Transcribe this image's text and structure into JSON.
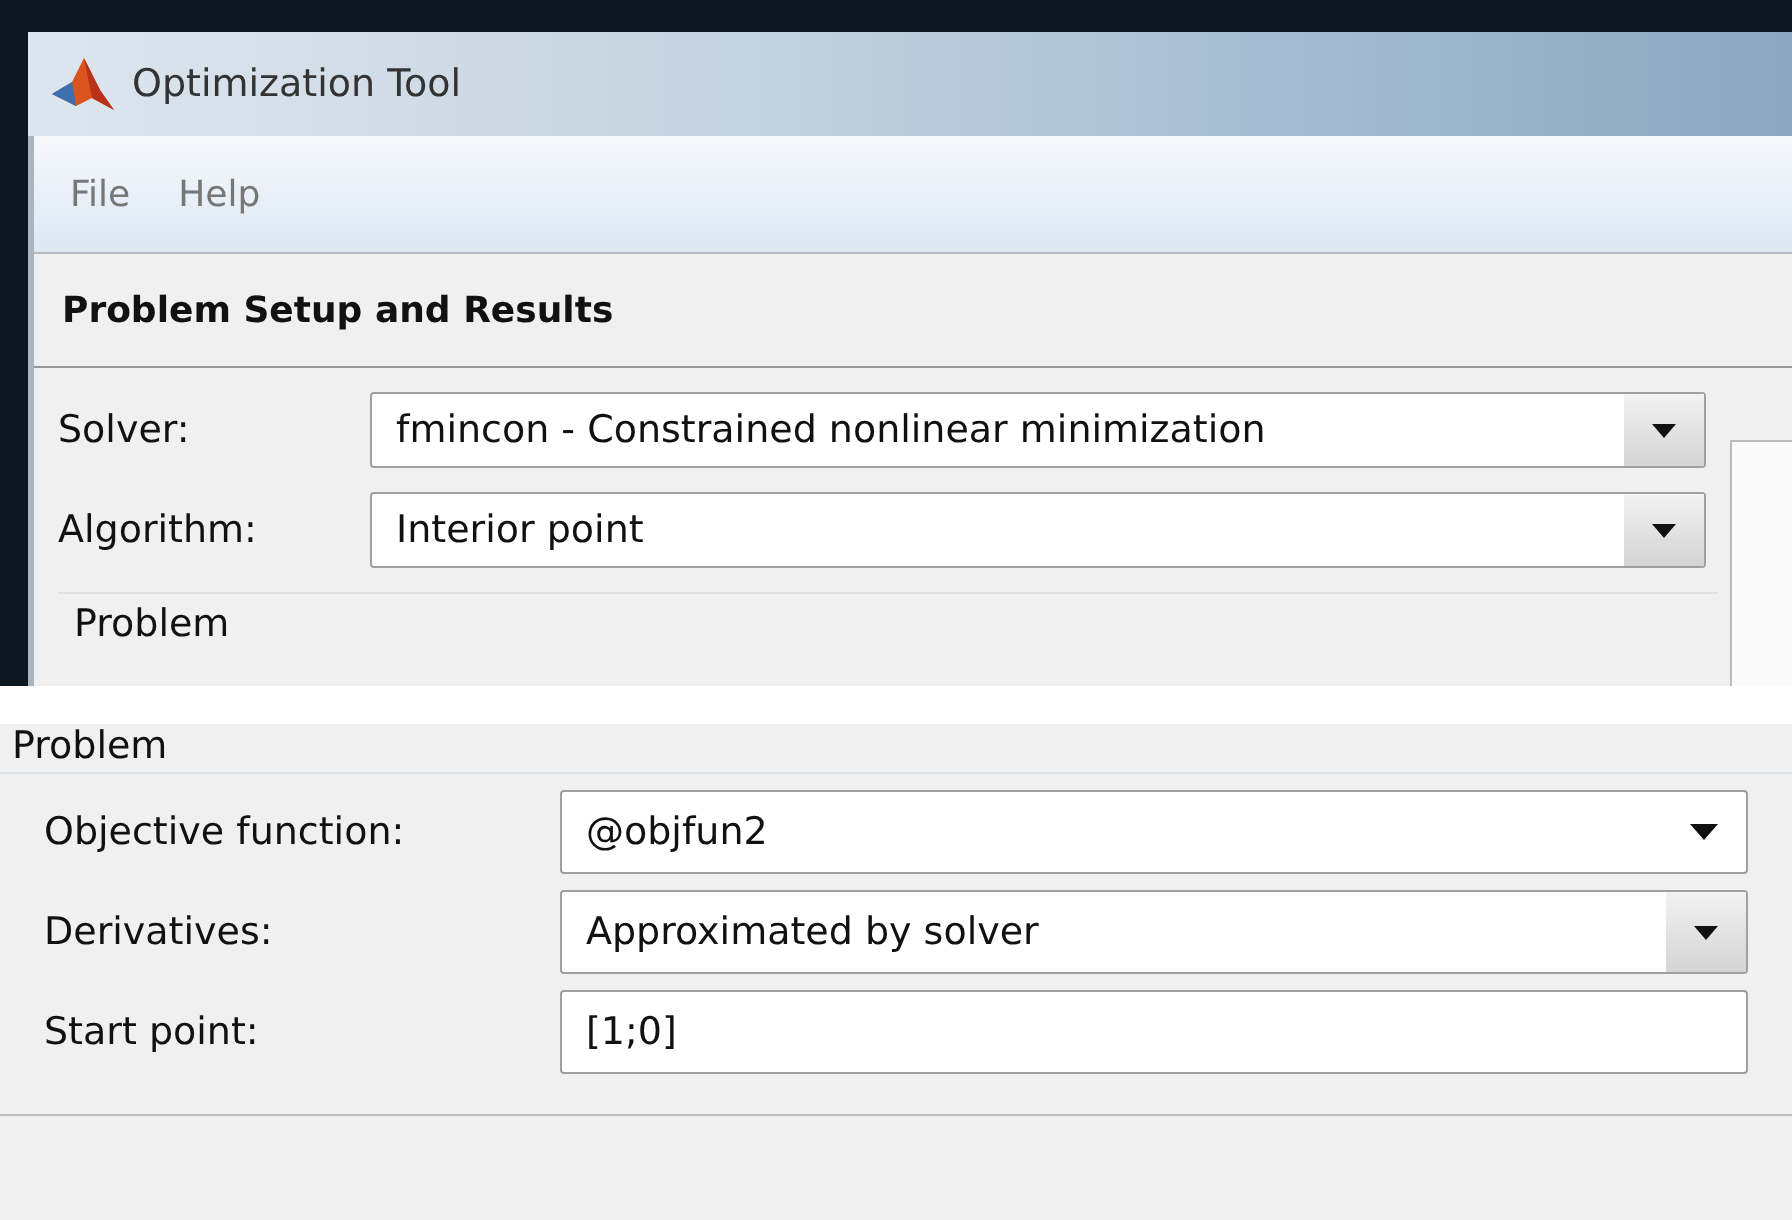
{
  "window": {
    "title": "Optimization Tool"
  },
  "menu": [
    {
      "label": "File"
    },
    {
      "label": "Help"
    }
  ],
  "section_title": "Problem Setup and Results",
  "setup_fields": [
    {
      "label": "Solver:",
      "value": "fmincon - Constrained nonlinear minimization",
      "kind": "dropdown"
    },
    {
      "label": "Algorithm:",
      "value": "Interior point",
      "kind": "dropdown"
    }
  ],
  "setup_group_title": "Problem",
  "problem": {
    "title": "Problem",
    "fields": [
      {
        "label": "Objective function:",
        "value": "@objfun2",
        "kind": "combo"
      },
      {
        "label": "Derivatives:",
        "value": "Approximated by solver",
        "kind": "dropdown"
      },
      {
        "label": "Start point:",
        "value": "[1;0]",
        "kind": "text"
      }
    ]
  }
}
